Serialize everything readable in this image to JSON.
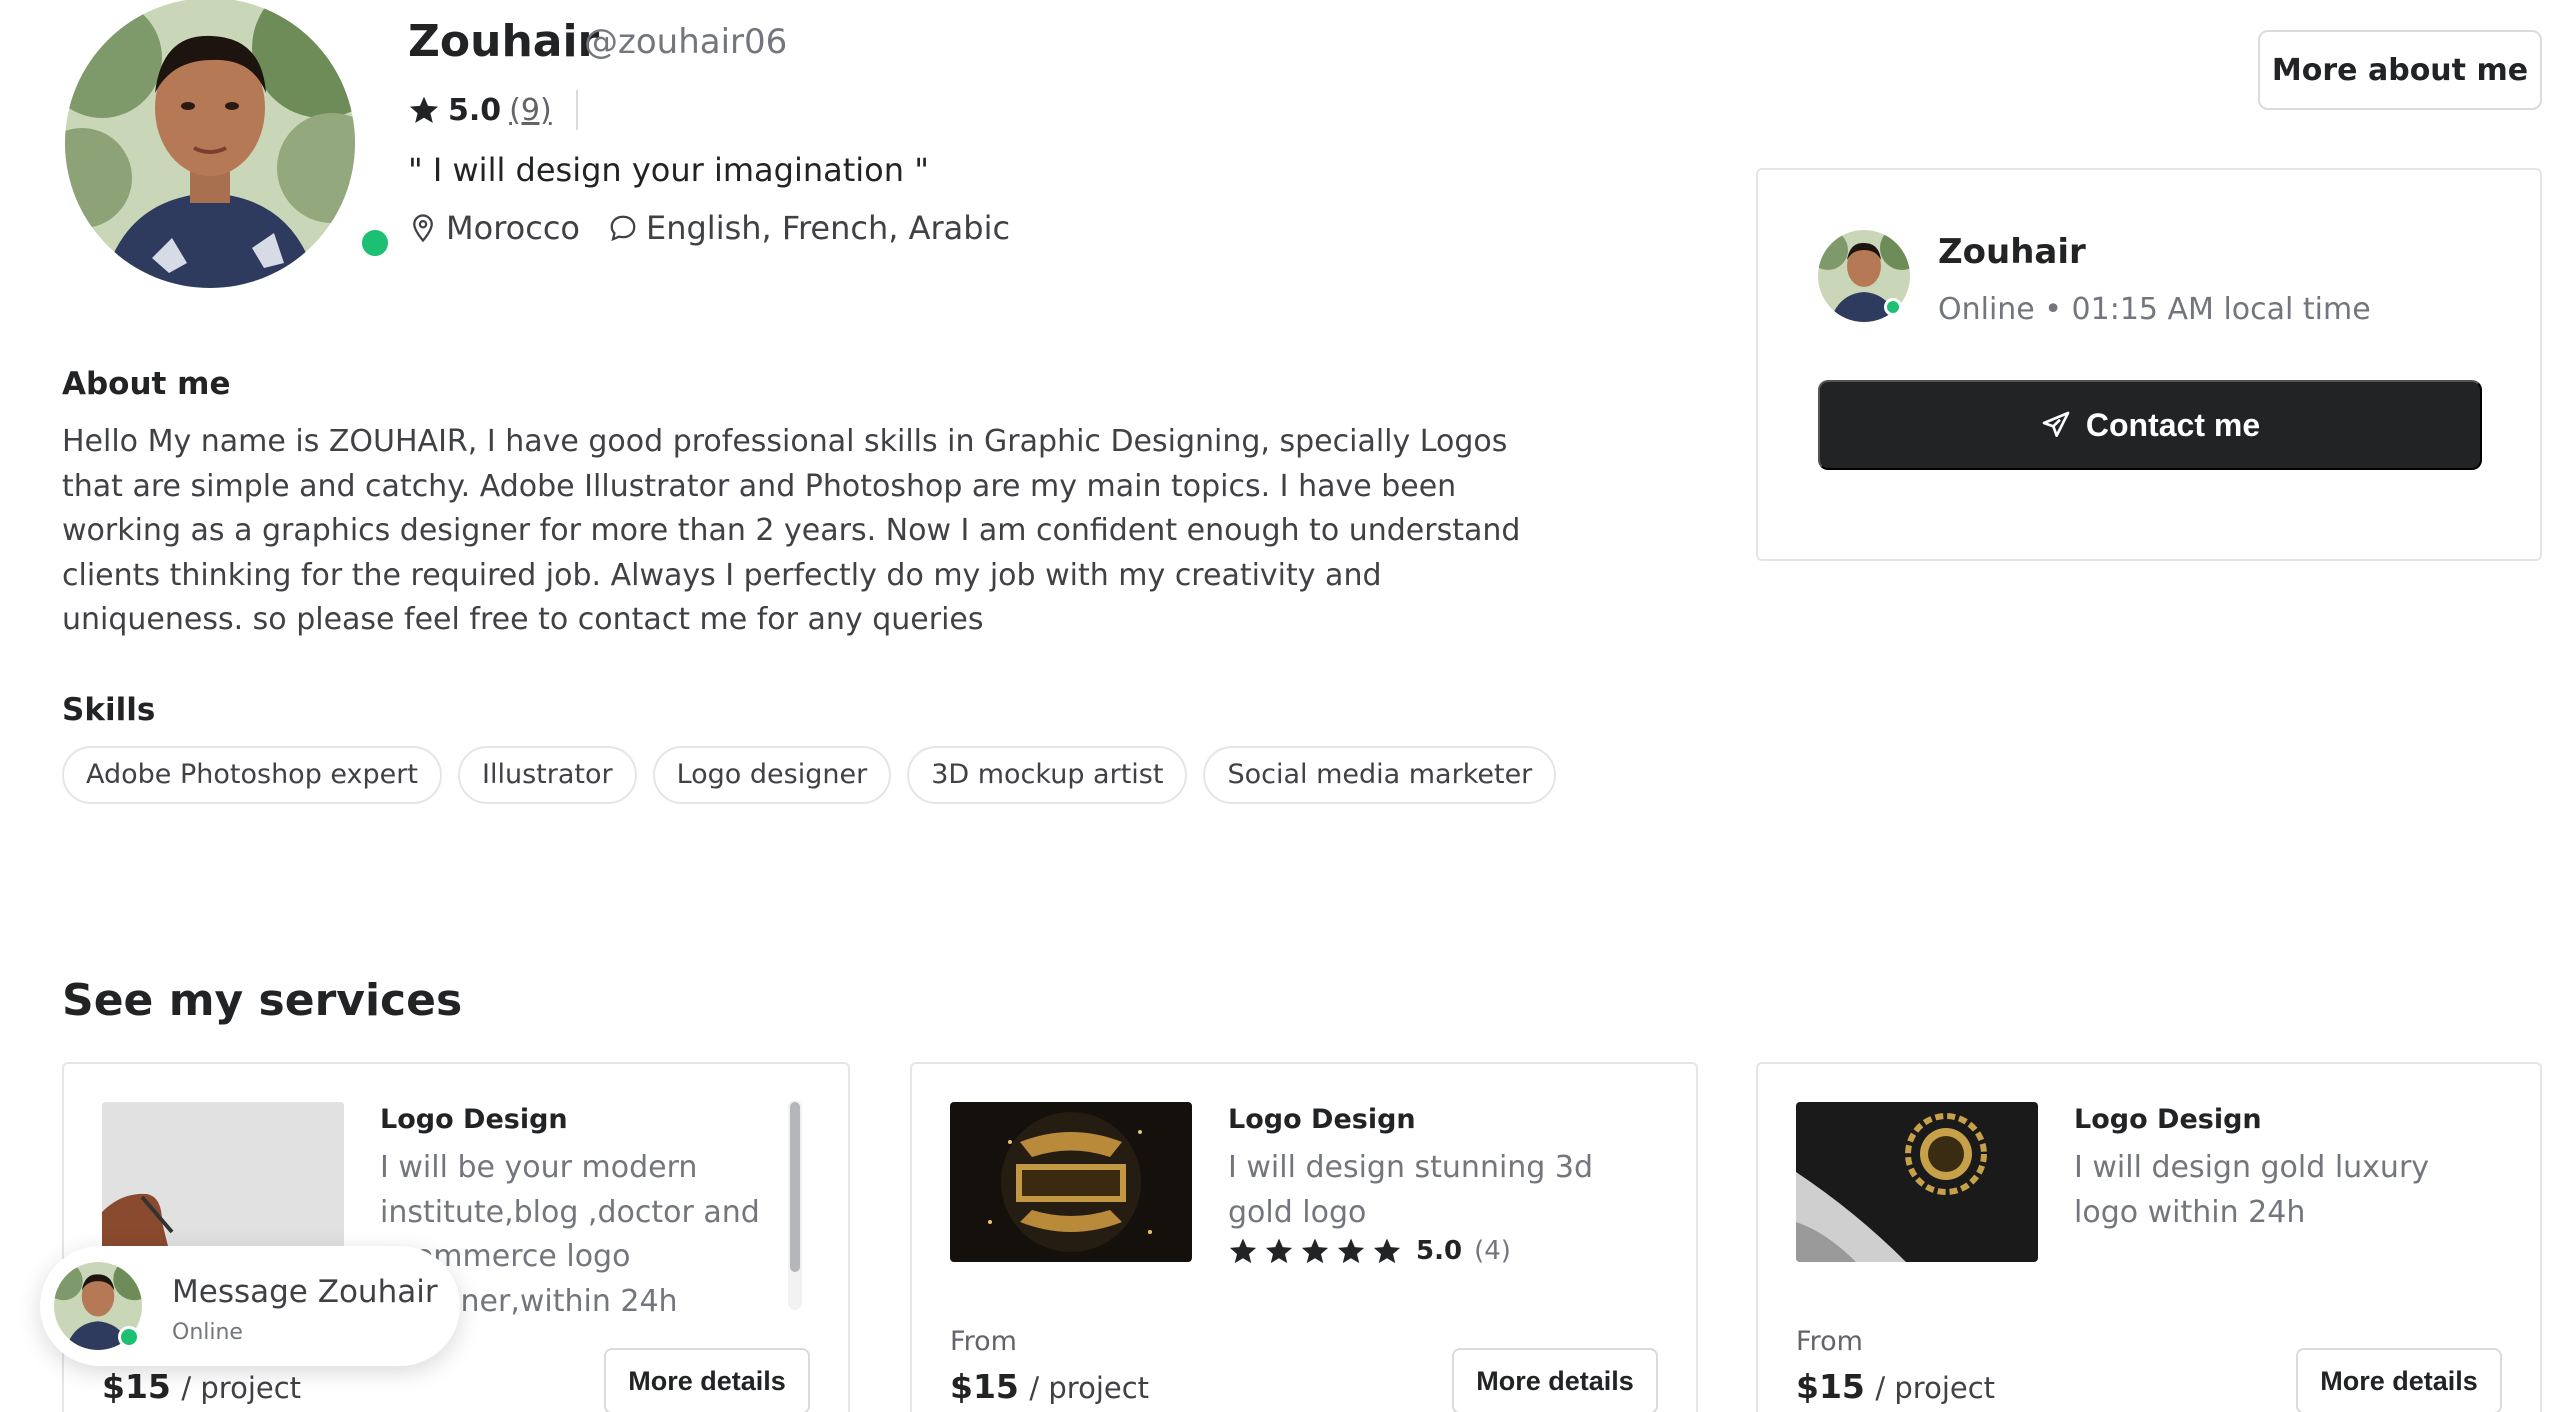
{
  "profile": {
    "name": "Zouhair",
    "handle": "@zouhair06",
    "rating": "5.0",
    "rating_count": "(9)",
    "tagline": "\" I will design your imagination \"",
    "location": "Morocco",
    "languages": "English, French, Arabic",
    "status_color": "#1dbf73"
  },
  "about": {
    "title": "About me",
    "text": "Hello My name is ZOUHAIR, I have good professional skills in Graphic Designing, specially Logos that are simple and catchy. Adobe Illustrator and Photoshop are my main topics. I have been working as a graphics designer for more than 2 years. Now I am confident enough to understand clients thinking for the required job. Always I perfectly do my job with my creativity and uniqueness. so please feel free to contact me for any queries"
  },
  "skills": {
    "title": "Skills",
    "items": [
      "Adobe Photoshop expert",
      "Illustrator",
      "Logo designer",
      "3D mockup artist",
      "Social media marketer"
    ]
  },
  "header": {
    "more_about_label": "More about me"
  },
  "contact_card": {
    "name": "Zouhair",
    "status": "Online • 01:15 AM local time",
    "button_label": "Contact me"
  },
  "services": {
    "title": "See my services",
    "items": [
      {
        "category": "Logo Design",
        "description": "I will be your modern institute,blog ,doctor and ecommerce logo designer,within 24h",
        "from": "",
        "price": "$15",
        "unit": "/ project",
        "more_label": "More details"
      },
      {
        "category": "Logo Design",
        "description": "I will design stunning 3d gold logo",
        "rating": "5.0",
        "rating_count": "(4)",
        "from": "From",
        "price": "$15",
        "unit": "/ project",
        "more_label": "More details"
      },
      {
        "category": "Logo Design",
        "description": "I will design gold luxury logo within 24h",
        "from": "From",
        "price": "$15",
        "unit": "/ project",
        "more_label": "More details"
      }
    ]
  },
  "message_bubble": {
    "title": "Message Zouhair",
    "status": "Online"
  }
}
